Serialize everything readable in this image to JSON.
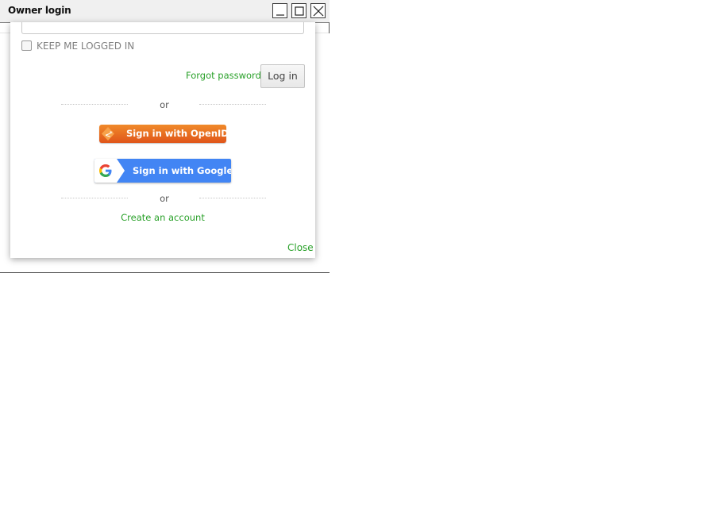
{
  "window": {
    "title": "Owner login",
    "buttons": {
      "minimize_icon": "minimize-icon",
      "maximize_icon": "maximize-icon",
      "close_icon": "close-icon"
    }
  },
  "login": {
    "keep_logged_in_label": "KEEP ME LOGGED IN",
    "keep_logged_in_checked": false,
    "forgot_password_label": "Forgot password",
    "login_button_label": "Log in"
  },
  "separators": {
    "first_or": "or",
    "second_or": "or"
  },
  "social": {
    "openid_label": "Sign in with OpenID",
    "openid_icon": "openid-icon",
    "google_label": "Sign in with Google",
    "google_icon": "google-g-icon"
  },
  "footer": {
    "create_account_label": "Create an account",
    "close_label": "Close"
  },
  "colors": {
    "link_green": "#2aa12a",
    "openid_orange": "#e0551a",
    "google_blue": "#4285f4"
  }
}
